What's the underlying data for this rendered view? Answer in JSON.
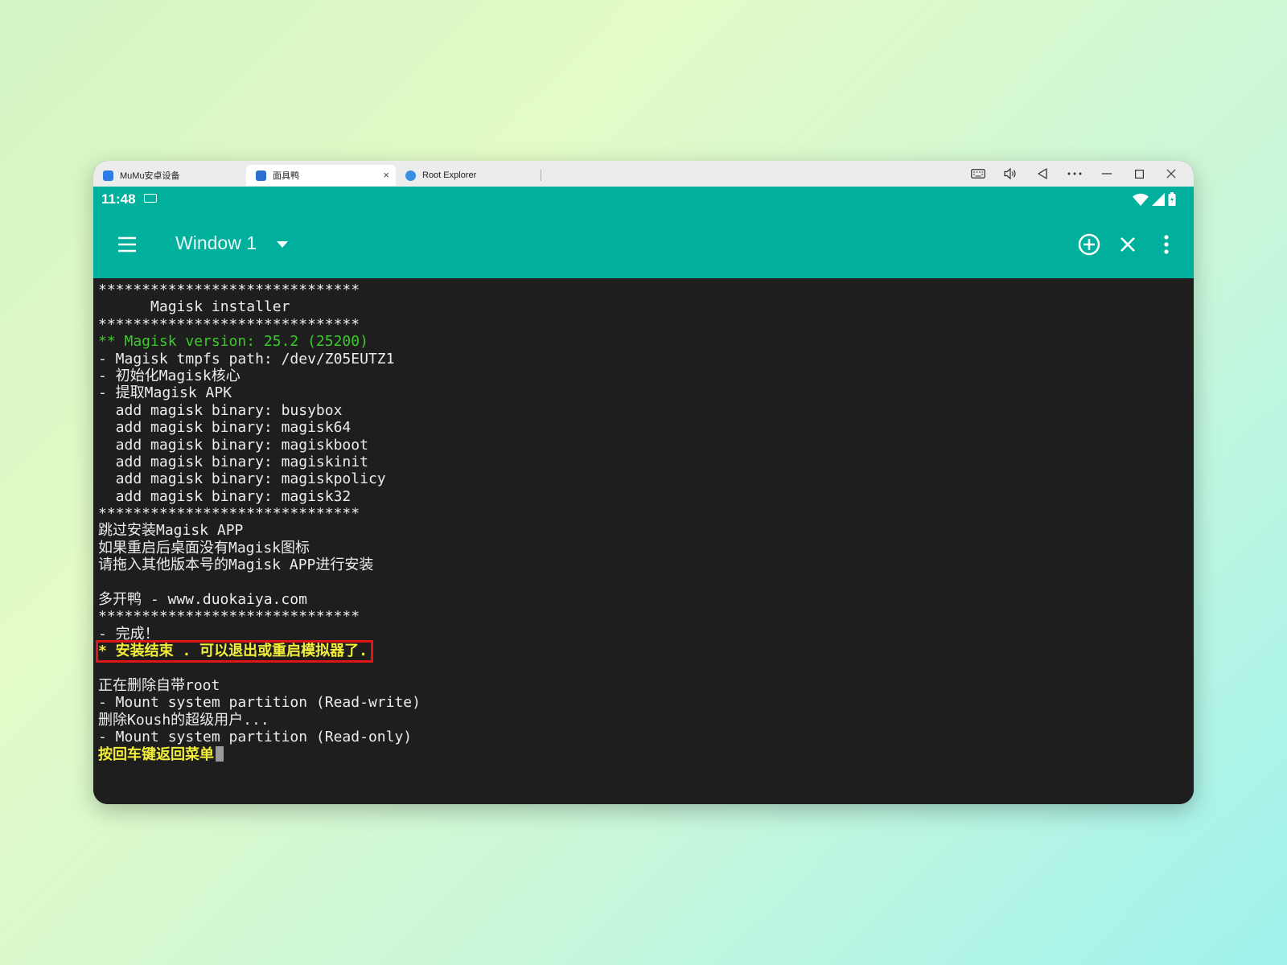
{
  "tabs": [
    {
      "label": "MuMu安卓设备",
      "icon_color": "#2d7be5"
    },
    {
      "label": "面具鸭",
      "icon_color": "#2d6fd0"
    },
    {
      "label": "Root Explorer",
      "icon_color": "#3a8fe0"
    }
  ],
  "tab_close_icon": "×",
  "window_controls": [
    "keyboard-icon",
    "volume-icon",
    "back-icon",
    "more-icon",
    "minimize-icon",
    "maximize-icon",
    "close-icon"
  ],
  "status": {
    "time": "11:48"
  },
  "appbar": {
    "title": "Window 1",
    "accent": "#00b09c"
  },
  "terminal": {
    "lines": [
      {
        "text": "******************************",
        "style": ""
      },
      {
        "text": "      Magisk installer",
        "style": ""
      },
      {
        "text": "******************************",
        "style": ""
      },
      {
        "text": "** Magisk version: 25.2 (25200)",
        "style": "green"
      },
      {
        "text": "- Magisk tmpfs path: /dev/Z05EUTZ1",
        "style": ""
      },
      {
        "text": "- 初始化Magisk核心",
        "style": ""
      },
      {
        "text": "- 提取Magisk APK",
        "style": ""
      },
      {
        "text": "  add magisk binary: busybox",
        "style": ""
      },
      {
        "text": "  add magisk binary: magisk64",
        "style": ""
      },
      {
        "text": "  add magisk binary: magiskboot",
        "style": ""
      },
      {
        "text": "  add magisk binary: magiskinit",
        "style": ""
      },
      {
        "text": "  add magisk binary: magiskpolicy",
        "style": ""
      },
      {
        "text": "  add magisk binary: magisk32",
        "style": ""
      },
      {
        "text": "******************************",
        "style": ""
      },
      {
        "text": "跳过安装Magisk APP",
        "style": ""
      },
      {
        "text": "如果重启后桌面没有Magisk图标",
        "style": ""
      },
      {
        "text": "请拖入其他版本号的Magisk APP进行安装",
        "style": ""
      },
      {
        "text": "",
        "style": ""
      },
      {
        "text": "多开鸭 - www.duokaiya.com",
        "style": ""
      },
      {
        "text": "******************************",
        "style": ""
      },
      {
        "text": "- 完成！",
        "style": ""
      },
      {
        "text": "* 安装结束 . 可以退出或重启模拟器了.",
        "style": "yellow boxed"
      },
      {
        "text": "",
        "style": ""
      },
      {
        "text": "正在删除自带root",
        "style": ""
      },
      {
        "text": "- Mount system partition (Read-write)",
        "style": ""
      },
      {
        "text": "删除Koush的超级用户...",
        "style": ""
      },
      {
        "text": "- Mount system partition (Read-only)",
        "style": ""
      },
      {
        "text": "按回车键返回菜单",
        "style": "yellow cursor-line"
      }
    ]
  }
}
